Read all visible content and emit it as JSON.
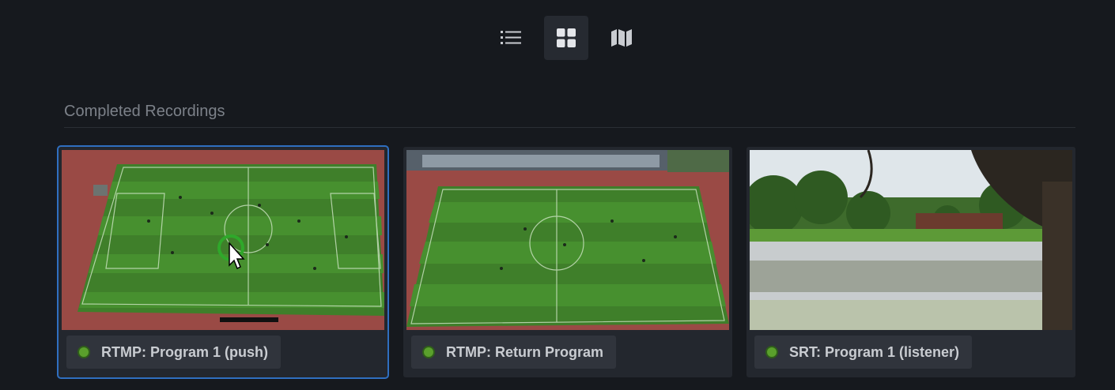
{
  "toolbar": {
    "views": [
      {
        "name": "list-view",
        "icon": "list-icon",
        "active": false
      },
      {
        "name": "grid-view",
        "icon": "grid-icon",
        "active": true
      },
      {
        "name": "map-view",
        "icon": "map-icon",
        "active": false
      }
    ]
  },
  "section": {
    "title": "Completed Recordings"
  },
  "recordings": [
    {
      "label": "RTMP: Program 1 (push)",
      "status": "online",
      "status_color": "#5aa02c",
      "thumbnail": "aerial-soccer-field",
      "selected": true
    },
    {
      "label": "RTMP: Return Program",
      "status": "online",
      "status_color": "#5aa02c",
      "thumbnail": "aerial-soccer-field-stands",
      "selected": false
    },
    {
      "label": "SRT: Program 1 (listener)",
      "status": "online",
      "status_color": "#5aa02c",
      "thumbnail": "pond-with-trees",
      "selected": false
    }
  ],
  "colors": {
    "background": "#16191e",
    "accent": "#2f6fc0",
    "status_ok": "#5aa02c"
  }
}
